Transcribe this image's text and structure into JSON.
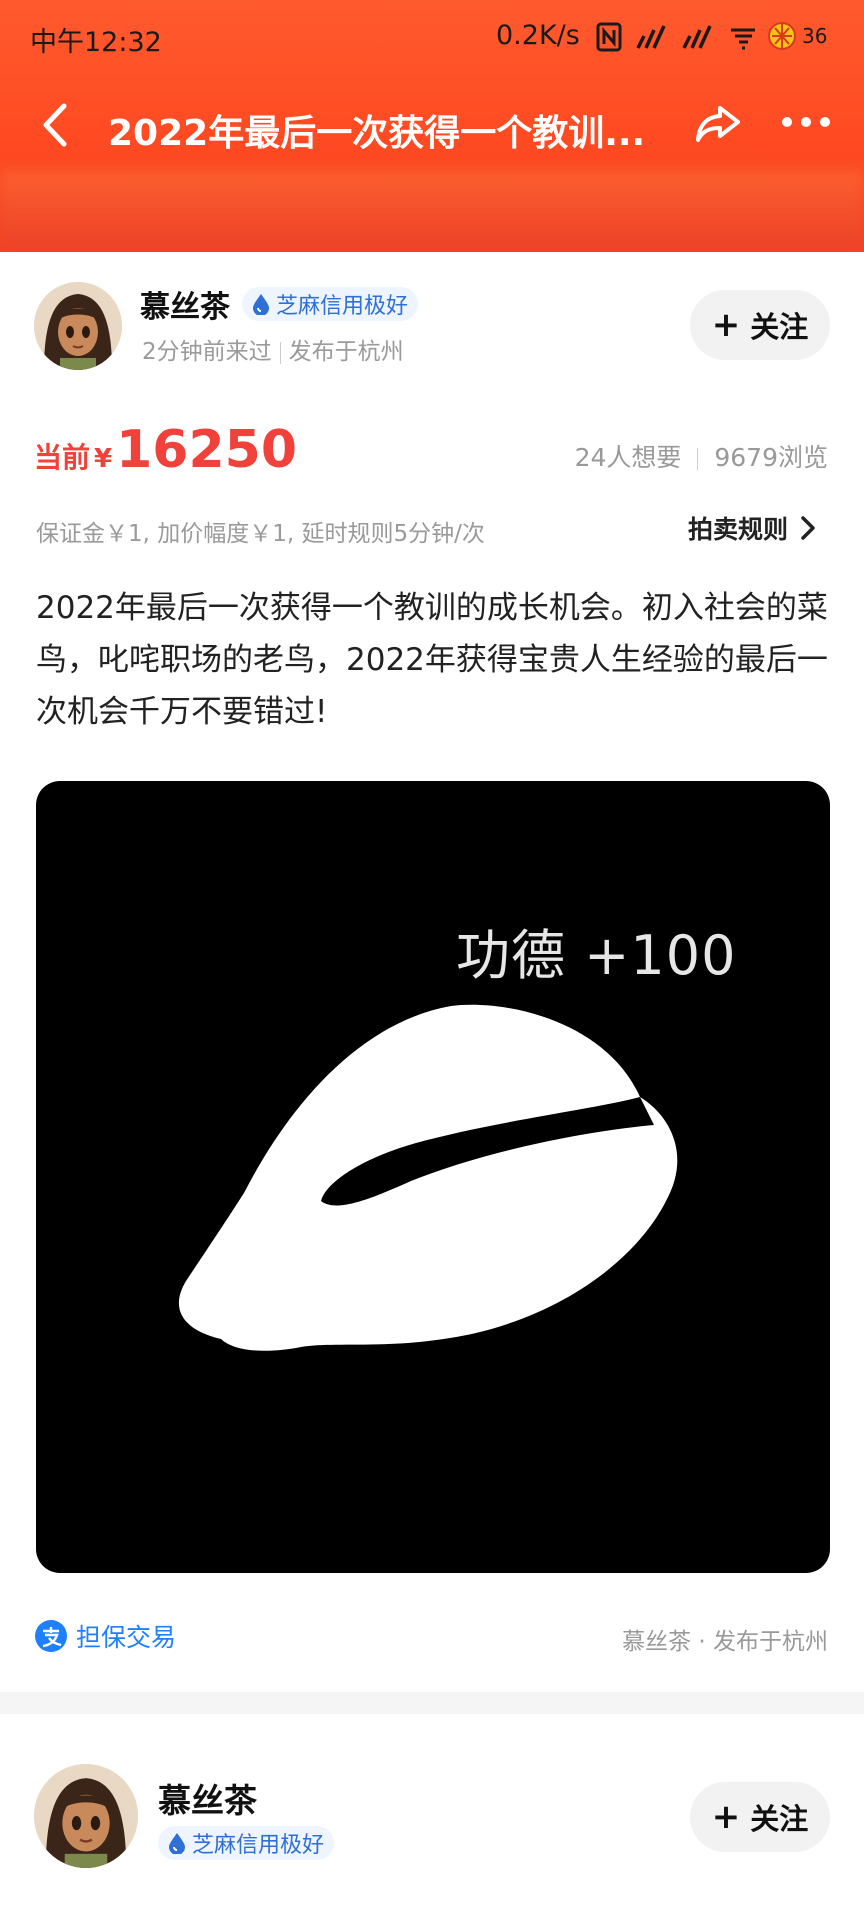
{
  "status_bar": {
    "time": "中午12:32",
    "network_speed": "0.2K/s",
    "battery": "36"
  },
  "nav": {
    "title": "2022年最后一次获得一个教训..."
  },
  "seller": {
    "name": "慕丝茶",
    "credit_badge": "芝麻信用极好",
    "last_seen": "2分钟前来过",
    "location": "发布于杭州",
    "follow_label": "关注"
  },
  "price": {
    "prefix": "当前",
    "currency": "¥",
    "value": "16250",
    "wants": "24人想要",
    "views": "9679浏览"
  },
  "auction": {
    "info": "保证金￥1, 加价幅度￥1, 延时规则5分钟/次",
    "rules_link": "拍卖规则"
  },
  "description": "2022年最后一次获得一个教训的成长机会。初入社会的菜鸟，叱咤职场的老鸟，2022年获得宝贵人生经验的最后一次机会千万不要错过!",
  "image": {
    "caption": "功德 +100"
  },
  "footer": {
    "guarantee": "担保交易",
    "seller_location": "慕丝茶 · 发布于杭州"
  },
  "seller2": {
    "name": "慕丝茶",
    "credit_badge": "芝麻信用极好",
    "follow_label": "关注"
  },
  "colors": {
    "header": "#ff4a22",
    "price": "#f0413a",
    "badge": "#2f6fd6",
    "guarantee": "#1e80ff"
  }
}
